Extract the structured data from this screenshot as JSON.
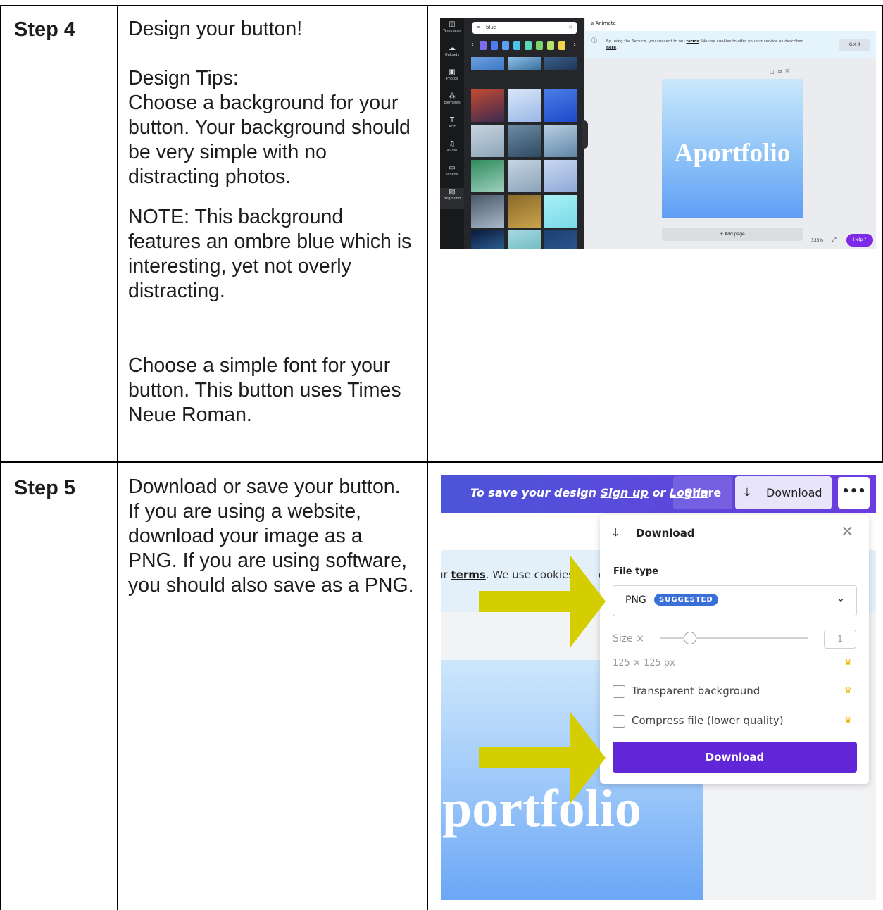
{
  "rows": [
    {
      "step": "Step 4",
      "instructions": {
        "p1": "Design your button!",
        "p2": "Design Tips:\nChoose a background for your button. Your background should be very simple with no distracting photos.",
        "p3": "NOTE: This background features an ombre blue which is interesting, yet not overly distracting.",
        "p4": "Choose a simple font for your button. This button uses Times Neue Roman."
      }
    },
    {
      "step": "Step 5",
      "instructions": {
        "p1": "Download or save your button. If you are using a website, download your image as a PNG. If you are using software, you should also save as a PNG."
      }
    }
  ],
  "editor": {
    "rail": [
      {
        "label": "Templates",
        "icon": "templates-icon",
        "glyph": "◫"
      },
      {
        "label": "Uploads",
        "icon": "upload-cloud-icon",
        "glyph": "☁"
      },
      {
        "label": "Photos",
        "icon": "photo-icon",
        "glyph": "▣"
      },
      {
        "label": "Elements",
        "icon": "shapes-icon",
        "glyph": "⁂"
      },
      {
        "label": "Text",
        "icon": "text-icon",
        "glyph": "T"
      },
      {
        "label": "Audio",
        "icon": "music-note-icon",
        "glyph": "♫"
      },
      {
        "label": "Videos",
        "icon": "video-icon",
        "glyph": "▭"
      },
      {
        "label": "Bkground",
        "icon": "background-icon",
        "glyph": "▨"
      }
    ],
    "search_value": "blue",
    "animate_label": "Animate",
    "cookie_text": "By using the Service, you consent to our",
    "cookie_terms": "terms",
    "cookie_text2": ". We use cookies to offer you our service as described",
    "cookie_here": "here",
    "got_it": "Got it",
    "canvas_text": "Aportfolio",
    "add_page": "+ Add page",
    "zoom": "335%",
    "help": "Help ?",
    "swatch_colors": [
      "#7b6cf0",
      "#4f7df0",
      "#5aa0f5",
      "#4cc3e8",
      "#5ad6b8",
      "#7fd46a",
      "#b8e06a",
      "#f0d44a"
    ]
  },
  "download_ui": {
    "save_prefix": "To save your design",
    "sign_up": "Sign up",
    "or": "or",
    "log_in": "Log in",
    "share": "Share",
    "download_top": "Download",
    "more": "•••",
    "cookie_partial_prefix": "ur",
    "cookie_terms": "terms",
    "cookie_partial_suffix": ". We use cookies",
    "cookie_of": "of",
    "canvas_text": "portfolio",
    "panel": {
      "title": "Download",
      "file_type_label": "File type",
      "file_type_value": "PNG",
      "suggested_badge": "SUGGESTED",
      "size_label": "Size ×",
      "size_value": "1",
      "dimensions": "125 × 125 px",
      "transparent_label": "Transparent background",
      "compress_label": "Compress file (lower quality)",
      "download_button": "Download"
    },
    "arrow_color": "#d4cd00",
    "accent": "#6226d9"
  }
}
